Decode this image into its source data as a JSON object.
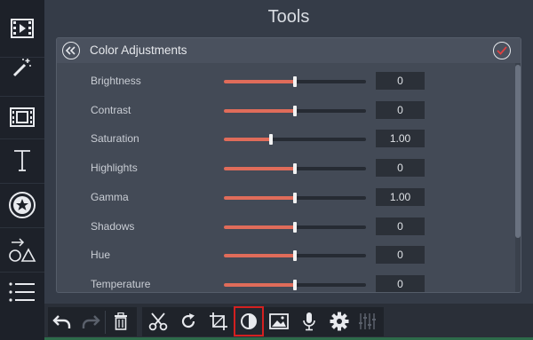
{
  "panel": {
    "title": "Tools"
  },
  "card": {
    "title": "Color Adjustments",
    "accent_color": "#e06c5a",
    "rows": [
      {
        "label": "Brightness",
        "value": "0",
        "position": 0.5
      },
      {
        "label": "Contrast",
        "value": "0",
        "position": 0.5
      },
      {
        "label": "Saturation",
        "value": "1.00",
        "position": 0.33
      },
      {
        "label": "Highlights",
        "value": "0",
        "position": 0.5
      },
      {
        "label": "Gamma",
        "value": "1.00",
        "position": 0.5
      },
      {
        "label": "Shadows",
        "value": "0",
        "position": 0.5
      },
      {
        "label": "Hue",
        "value": "0",
        "position": 0.5
      },
      {
        "label": "Temperature",
        "value": "0",
        "position": 0.5
      }
    ]
  },
  "rail": {
    "items": [
      "media-icon",
      "magic-wand-icon",
      "film-clip-icon",
      "text-icon",
      "sticker-icon",
      "shapes-icon",
      "list-icon"
    ]
  },
  "toolbar": {
    "items": [
      "undo-icon",
      "redo-icon",
      "trash-icon",
      "scissors-icon",
      "rotate-icon",
      "crop-icon",
      "color-adjust-icon",
      "image-icon",
      "microphone-icon",
      "gear-icon",
      "equalizer-icon"
    ],
    "active": "color-adjust-icon",
    "active_color": "#d42020"
  }
}
